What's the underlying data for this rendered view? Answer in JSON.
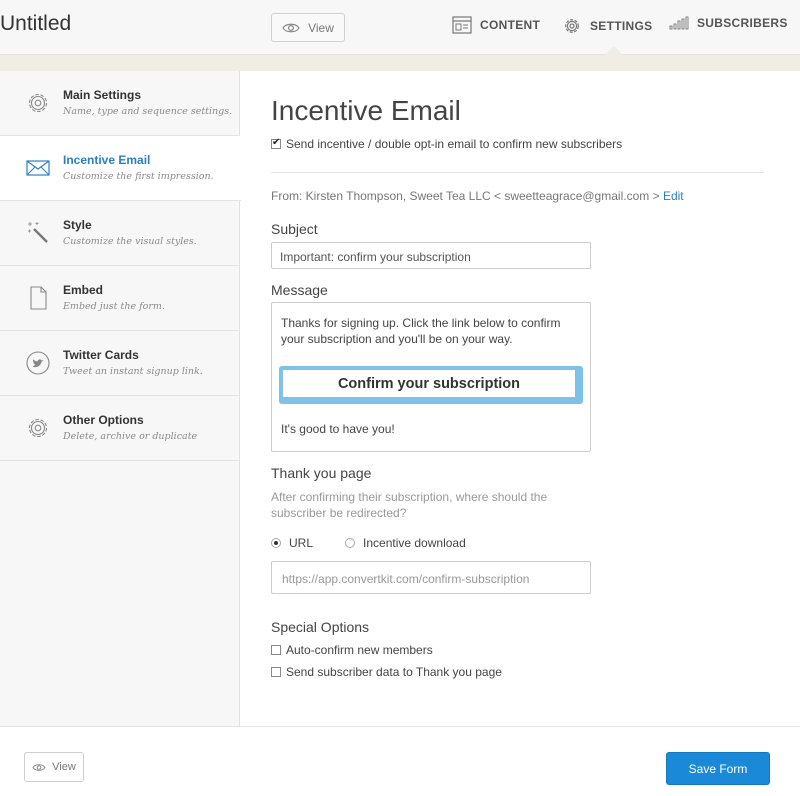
{
  "app": {
    "title": "Untitled"
  },
  "topnav": {
    "view_label": "View",
    "tabs": [
      {
        "label": "CONTENT",
        "icon": "content-icon"
      },
      {
        "label": "SETTINGS",
        "icon": "gear-icon",
        "active": true
      },
      {
        "label": "SUBSCRIBERS",
        "icon": "bar-chart-icon"
      }
    ]
  },
  "sidebar": {
    "items": [
      {
        "title": "Main Settings",
        "subtitle": "Name, type and sequence settings.",
        "icon": "gear-icon"
      },
      {
        "title": "Incentive Email",
        "subtitle": "Customize the first impression.",
        "icon": "envelope-icon",
        "active": true
      },
      {
        "title": "Style",
        "subtitle": "Customize the visual styles.",
        "icon": "magic-wand-icon"
      },
      {
        "title": "Embed",
        "subtitle": "Embed just the form.",
        "icon": "document-icon"
      },
      {
        "title": "Twitter Cards",
        "subtitle": "Tweet an instant signup link.",
        "icon": "twitter-icon"
      },
      {
        "title": "Other Options",
        "subtitle": "Delete, archive or duplicate",
        "icon": "gear-icon"
      }
    ]
  },
  "main": {
    "heading": "Incentive Email",
    "send_incentive_label": "Send incentive / double opt-in email to confirm new subscribers",
    "send_incentive_checked": true,
    "from_text": "From: Kirsten Thompson, Sweet Tea LLC < sweetteagrace@gmail.com >",
    "from_edit_link": "Edit",
    "subject_label": "Subject",
    "subject_value": "Important: confirm your subscription",
    "message_label": "Message",
    "message_body": "Thanks for signing up. Click the link below to confirm your subscription and you'll be on your way.",
    "confirm_button_label": "Confirm your subscription",
    "message_footer": "It's good to have you!",
    "thankyou_label": "Thank you page",
    "thankyou_help": "After confirming their subscription, where should the subscriber be redirected?",
    "redirect_options": [
      {
        "label": "URL",
        "selected": true
      },
      {
        "label": "Incentive download",
        "selected": false
      }
    ],
    "url_placeholder": "https://app.convertkit.com/confirm-subscription",
    "special_options_label": "Special Options",
    "special_options": [
      {
        "label": "Auto-confirm new members",
        "checked": false
      },
      {
        "label": "Send subscriber data to Thank you page",
        "checked": false
      }
    ]
  },
  "footer": {
    "view_label": "View",
    "save_label": "Save Form"
  },
  "colors": {
    "accent": "#2b7fc2",
    "save_button": "#1a8ad8",
    "confirm_border": "#7ec2ea",
    "header_strip": "#efede4"
  }
}
